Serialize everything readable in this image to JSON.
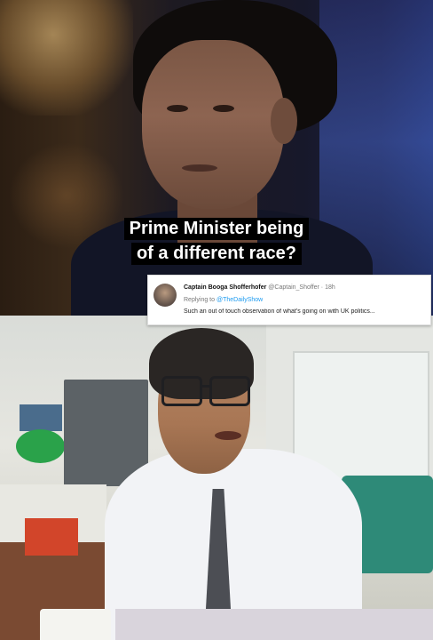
{
  "caption": {
    "line1": "Prime Minister being",
    "line2": "of a different race?"
  },
  "tweet": {
    "name": "Captain Booga Shofferhofer",
    "handle": "@Captain_Shoffer · 18h",
    "replying_prefix": "Replying to",
    "replying_to": "@TheDailyShow",
    "text": "Such an out of touch observation of what's going on with UK politics..."
  }
}
